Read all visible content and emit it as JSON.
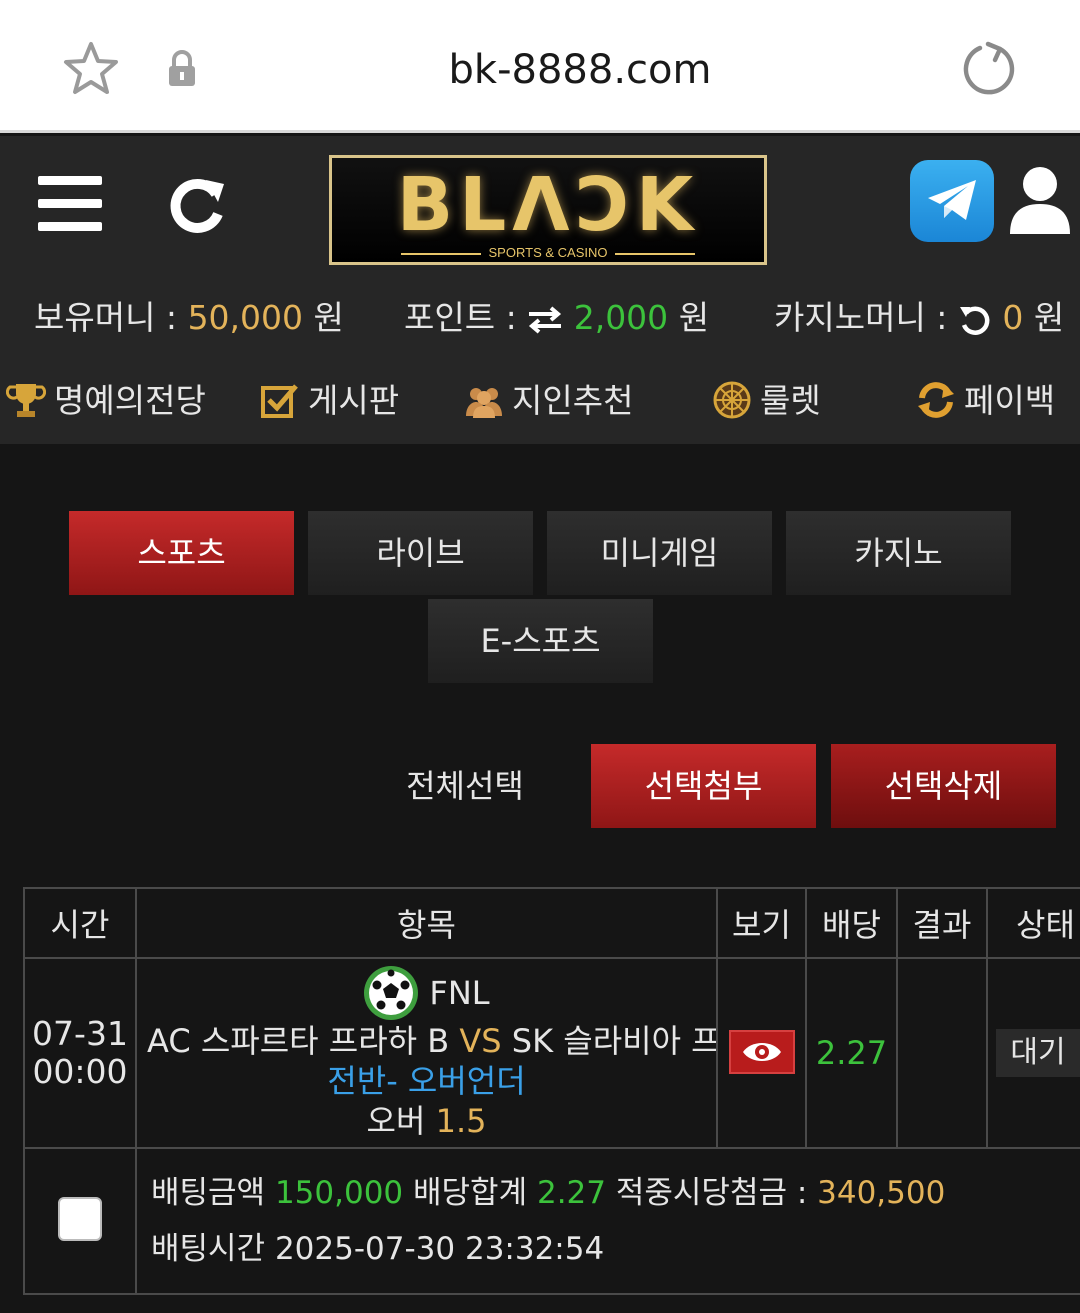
{
  "browser": {
    "url": "bk-8888.com"
  },
  "header": {
    "logo_text": "BLΛↃK",
    "logo_sub": "SPORTS & CASINO"
  },
  "balance": {
    "money_label": "보유머니 :",
    "money_value": "50,000",
    "money_unit": "원",
    "point_label": "포인트 :",
    "point_value": "2,000",
    "point_unit": "원",
    "casino_label": "카지노머니 :",
    "casino_value": "0",
    "casino_unit": "원"
  },
  "quick_menu": [
    {
      "label": "명예의전당",
      "icon": "trophy-icon"
    },
    {
      "label": "게시판",
      "icon": "checkbox-icon"
    },
    {
      "label": "지인추천",
      "icon": "people-icon"
    },
    {
      "label": "룰렛",
      "icon": "roulette-icon"
    },
    {
      "label": "페이백",
      "icon": "payback-icon"
    }
  ],
  "categories": [
    {
      "label": "스포츠",
      "active": true
    },
    {
      "label": "라이브",
      "active": false
    },
    {
      "label": "미니게임",
      "active": false
    },
    {
      "label": "카지노",
      "active": false
    },
    {
      "label": "E-스포츠",
      "active": false
    }
  ],
  "actions": {
    "select_all": "전체선택",
    "attach_selected": "선택첨부",
    "delete_selected": "선택삭제"
  },
  "table": {
    "headers": [
      "시간",
      "항목",
      "보기",
      "배당",
      "결과",
      "상태"
    ],
    "row": {
      "date": "07-31",
      "time": "00:00",
      "league": "FNL",
      "home": "AC 스파르타 프라하 B",
      "vs": "VS",
      "away": "SK 슬라비아 프라하 B",
      "market": "전반- 오버언더",
      "pick_label": "오버",
      "pick_value": "1.5",
      "odds": "2.27",
      "result": "",
      "status": "대기"
    },
    "summary": {
      "bet_amount_label": "배팅금액",
      "bet_amount": "150,000",
      "odds_total_label": "배당합계",
      "odds_total": "2.27",
      "payout_label": "적중시당첨금 :",
      "payout": "340,500",
      "bet_time_label": "배팅시간",
      "bet_time": "2025-07-30 23:32:54"
    }
  },
  "colors": {
    "gold": "#e3b35a",
    "green": "#3cc23c",
    "blue": "#3aa0e8",
    "red": "#c52a2a"
  }
}
